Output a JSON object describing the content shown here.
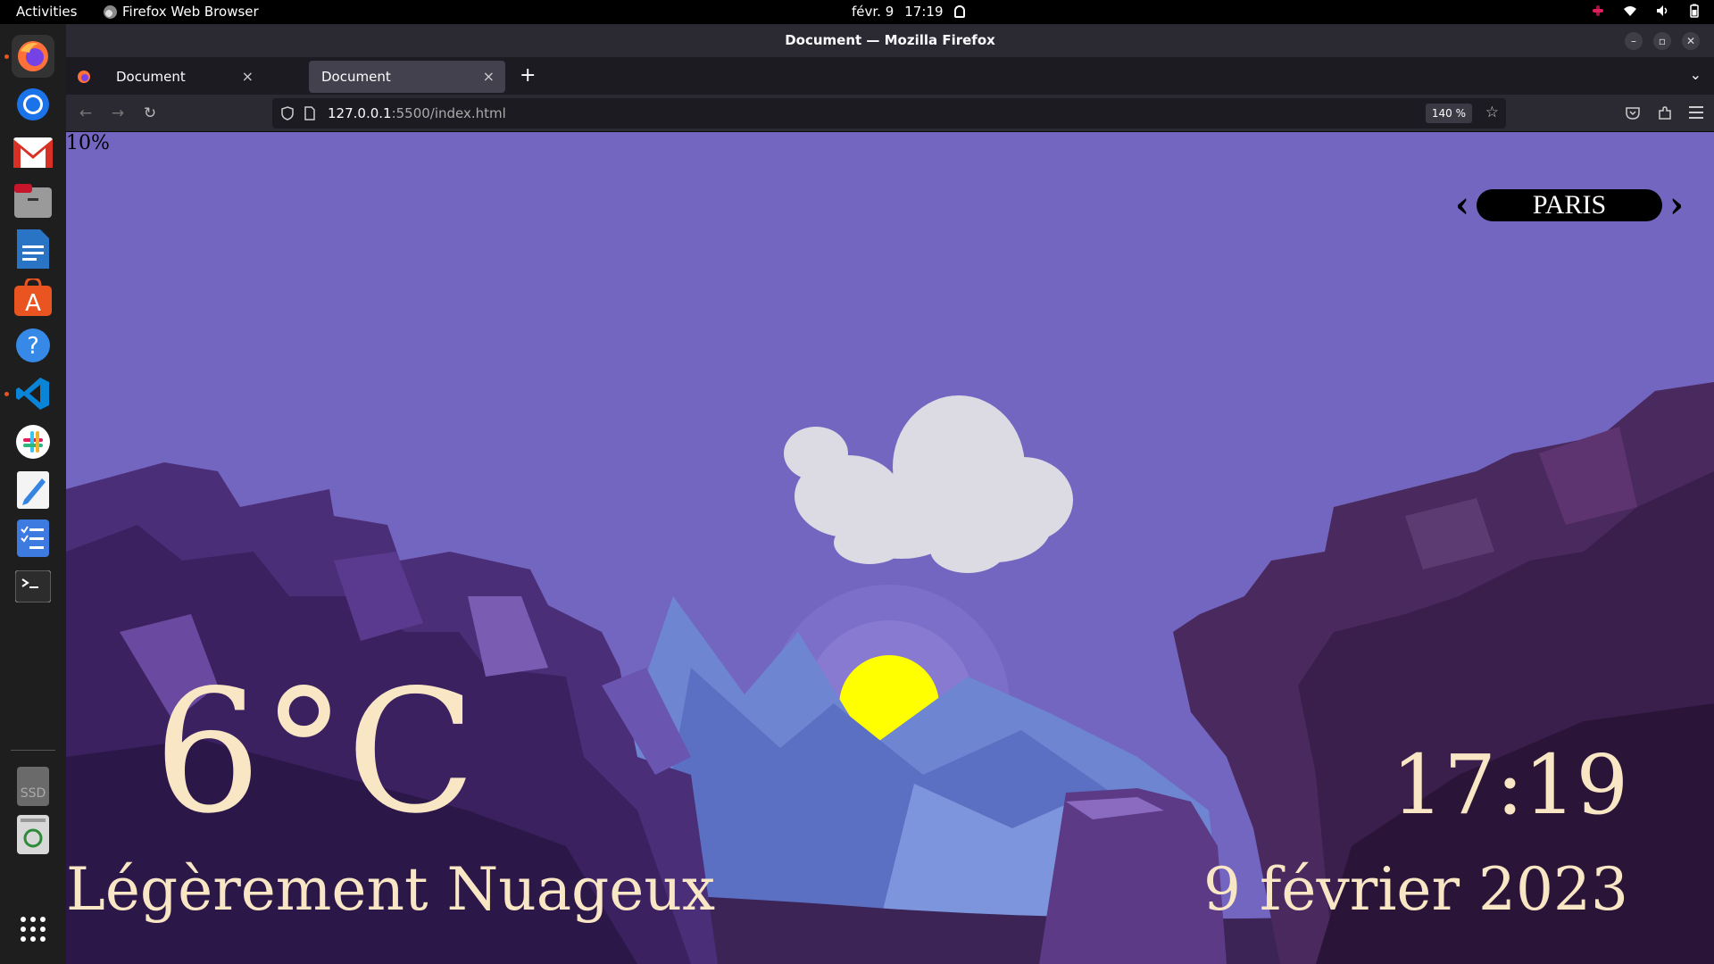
{
  "topbar": {
    "activities": "Activities",
    "app_name": "Firefox Web Browser",
    "date": "févr. 9",
    "time": "17:19"
  },
  "dock": {
    "items": [
      "firefox",
      "chromium",
      "gmail",
      "files",
      "libreoffice-writer",
      "app-center",
      "help",
      "vscode",
      "slack",
      "text-editor",
      "tasks",
      "terminal",
      "ssd-drive",
      "trash",
      "show-apps"
    ]
  },
  "browser": {
    "window_title": "Document — Mozilla Firefox",
    "tabs": [
      {
        "label": "Document",
        "active": false
      },
      {
        "label": "Document",
        "active": true
      }
    ],
    "url_host": "127.0.0.1",
    "url_path": ":5500/index.html",
    "zoom": "140 %"
  },
  "weather": {
    "percent": "10%",
    "city": "PARIS",
    "temperature": "6°C",
    "condition": "Légèrement Nuageux",
    "time": "17:19",
    "date": "9 février 2023"
  },
  "colors": {
    "sky": "#7366c1",
    "text": "#f9e6c5",
    "sun": "#ffff00",
    "cloud": "#dcdae3"
  }
}
